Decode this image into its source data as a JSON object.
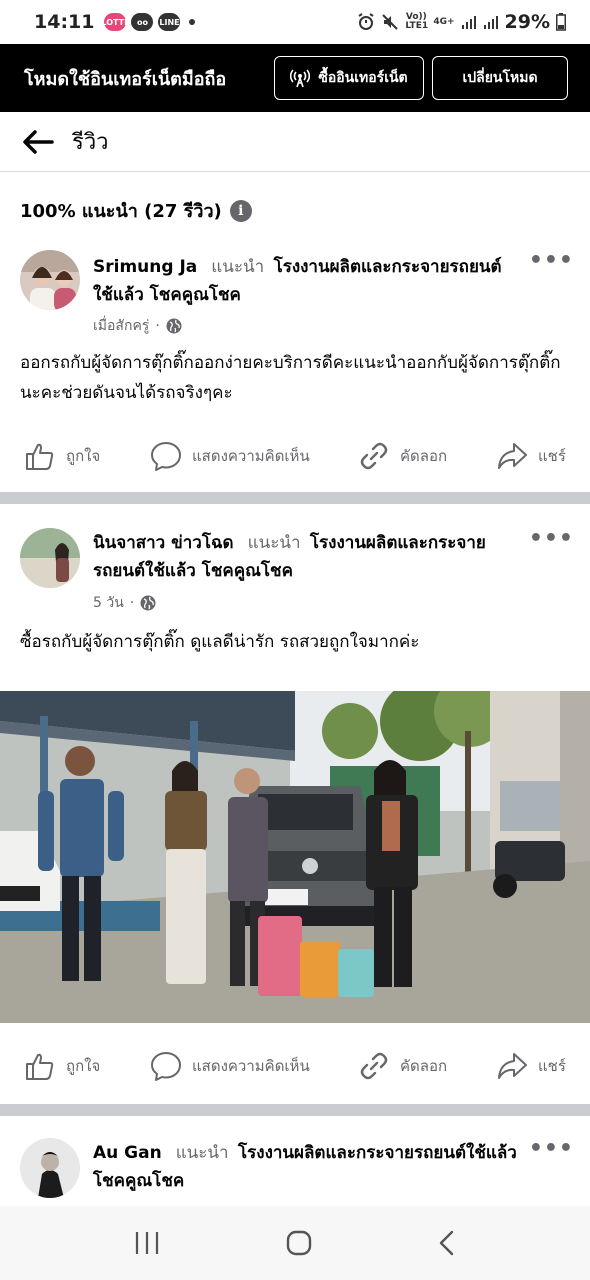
{
  "status": {
    "time": "14:11",
    "app_badges": [
      "LOTTE",
      "oo",
      "LINE"
    ],
    "network_volte": "Vo)) LTE1",
    "network_4g": "4G+",
    "battery": "29%"
  },
  "banner": {
    "title": "โหมดใช้อินเทอร์เน็ตมือถือ",
    "buy_label": "ซื้ออินเทอร์เน็ต",
    "switch_label": "เปลี่ยนโหมด"
  },
  "header": {
    "title": "รีวิว"
  },
  "summary": {
    "text": "100% แนะนำ (27 รีวิว)",
    "info_glyph": "i"
  },
  "posts": [
    {
      "author": "Srimung Ja",
      "recommends": "แนะนำ",
      "page": "โรงงานผลิตและกระจายรถยนต์ใช้แล้ว โชคคูณโชค",
      "time": "เมื่อสักครู่",
      "text": "ออกรถกับผู้จัดการตุ๊กติ๊กออกง่ายคะบริการดีคะแนะนำออกกับผู้จัดการตุ๊กติ๊กนะคะช่วยดันจนได้รถจริงๆคะ"
    },
    {
      "author": "นินจาสาว ข่าวโฉด",
      "recommends": "แนะนำ",
      "page": "โรงงานผลิตและกระจายรถยนต์ใช้แล้ว โชคคูณโชค",
      "time": "5 วัน",
      "text": "ซื้อรถกับผู้จัดการตุ๊กติ๊ก ดูแลดีน่ารัก รถสวยถูกใจมากค่ะ"
    },
    {
      "author": "Au Gan",
      "recommends": "แนะนำ",
      "page": "โรงงานผลิตและกระจายรถยนต์ใช้แล้ว โชคคูณโชค"
    }
  ],
  "actions": {
    "like": "ถูกใจ",
    "comment": "แสดงความคิดเห็น",
    "copy": "คัดลอก",
    "share": "แชร์"
  },
  "more_glyph": "•••",
  "meta_separator": "·",
  "icons": {
    "back": "arrow-left-icon",
    "info": "info-icon",
    "globe": "globe-icon",
    "like": "thumbs-up-icon",
    "comment": "speech-bubble-icon",
    "copy": "link-icon",
    "share": "share-arrow-icon",
    "nav_recents": "recents-icon",
    "nav_home": "home-icon",
    "nav_back": "chevron-left-icon"
  }
}
